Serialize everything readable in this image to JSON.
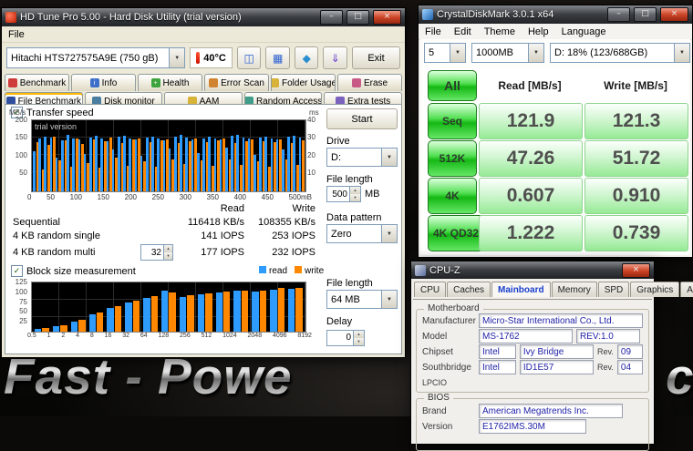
{
  "icons": {
    "minimize": "–",
    "maximize": "□",
    "close": "×",
    "dropdown": "▼",
    "check": "✓",
    "spin_up": "▲",
    "spin_down": "▼",
    "copy": "◫",
    "save": "▦",
    "screenshot": "◆",
    "upload": "⇓"
  },
  "wallpaper": {
    "caption": "Fast - Powe",
    "caption_right": "c"
  },
  "hdtune": {
    "title": "HD Tune Pro 5.00 - Hard Disk Utility (trial version)",
    "menu_file": "File",
    "drive_combo": "Hitachi HTS727575A9E (750 gB)",
    "temperature": "40°C",
    "exit_button": "Exit",
    "tabs_row1": [
      "Benchmark",
      "Info",
      "Health",
      "Error Scan",
      "Folder Usage",
      "Erase"
    ],
    "tabs_row2": [
      "File Benchmark",
      "Disk monitor",
      "AAM",
      "Random Access",
      "Extra tests"
    ],
    "active_tab": "File Benchmark",
    "transfer_speed_checkbox": "Transfer speed",
    "trial_watermark": "trial version",
    "start_button": "Start",
    "drive_label": "Drive",
    "drive_value": "D:",
    "file_length_label": "File length",
    "file_length_value": "500",
    "file_length_unit": "MB",
    "data_pattern_label": "Data pattern",
    "data_pattern_value": "Zero",
    "results_header_read": "Read",
    "results_header_write": "Write",
    "rows": {
      "sequential": {
        "label": "Sequential",
        "read": "116418 KB/s",
        "write": "108355 KB/s"
      },
      "random_single": {
        "label": "4 KB random single",
        "read": "141 IOPS",
        "write": "253 IOPS"
      },
      "random_multi": {
        "label": "4 KB random multi",
        "queue": "32",
        "read": "177 IOPS",
        "write": "232 IOPS"
      }
    },
    "block_checkbox": "Block size measurement",
    "legend_read": "read",
    "legend_write": "write",
    "file_length2_label": "File length",
    "file_length2_value": "64 MB",
    "delay_label": "Delay",
    "delay_value": "0",
    "transfer_chart": {
      "type": "bar",
      "y_unit_left": "MB/s",
      "y_ticks_left": [
        "200",
        "150",
        "100",
        "50"
      ],
      "y_unit_right": "ms",
      "y_ticks_right": [
        "40",
        "30",
        "20",
        "10"
      ],
      "x_ticks": [
        "0",
        "50",
        "100",
        "150",
        "200",
        "250",
        "300",
        "350",
        "400",
        "450",
        "500mB"
      ],
      "y_max": 200,
      "read_color": "#2e9bff",
      "write_color": "#ff8800",
      "read": [
        112,
        148,
        155,
        151,
        96,
        143,
        158,
        150,
        147,
        104,
        152,
        156,
        149,
        141,
        118,
        153,
        157,
        150,
        146,
        99,
        151,
        154,
        148,
        144,
        121,
        155,
        158,
        152,
        147,
        107,
        150,
        153,
        149,
        145,
        124,
        156,
        159,
        151,
        148,
        102,
        152,
        155,
        150,
        146,
        119,
        154,
        157,
        151
      ],
      "write": [
        139,
        62,
        131,
        154,
        88,
        144,
        70,
        149,
        134,
        79,
        147,
        66,
        141,
        151,
        94,
        137,
        73,
        145,
        149,
        84,
        139,
        68,
        143,
        147,
        91,
        135,
        76,
        142,
        150,
        87,
        138,
        71,
        144,
        148,
        89,
        136,
        74,
        140,
        146,
        85,
        141,
        70,
        139,
        145,
        90,
        137,
        75,
        143
      ]
    },
    "block_chart": {
      "type": "bar",
      "categories": [
        "0.5",
        "1",
        "2",
        "4",
        "8",
        "16",
        "32",
        "64",
        "128",
        "256",
        "512",
        "1024",
        "2048",
        "4096",
        "8192"
      ],
      "read": [
        7,
        14,
        26,
        44,
        60,
        73,
        86,
        104,
        89,
        95,
        100,
        104,
        101,
        107,
        108
      ],
      "write": [
        9,
        17,
        30,
        48,
        64,
        78,
        90,
        99,
        92,
        97,
        102,
        105,
        104,
        110,
        112
      ],
      "y_ticks": [
        "125",
        "100",
        "75",
        "50",
        "25"
      ],
      "y_max": 125
    }
  },
  "cdm": {
    "title": "CrystalDiskMark 3.0.1 x64",
    "menu": [
      "File",
      "Edit",
      "Theme",
      "Help",
      "Language"
    ],
    "run_count": "5",
    "test_size": "1000MB",
    "target": "D: 18% (123/688GB)",
    "header_read": "Read [MB/s]",
    "header_write": "Write [MB/s]",
    "all_button": "All",
    "accent_color": "#14b814",
    "tests": [
      {
        "label": "Seq",
        "read": "121.9",
        "write": "121.3"
      },
      {
        "label": "512K",
        "read": "47.26",
        "write": "51.72"
      },
      {
        "label": "4K",
        "read": "0.607",
        "write": "0.910"
      },
      {
        "label": "4K QD32",
        "read": "1.222",
        "write": "0.739"
      }
    ]
  },
  "cpuz": {
    "title": "CPU-Z",
    "tabs": [
      "CPU",
      "Caches",
      "Mainboard",
      "Memory",
      "SPD",
      "Graphics",
      "About"
    ],
    "active_tab": "Mainboard",
    "motherboard_group": "Motherboard",
    "manufacturer_label": "Manufacturer",
    "manufacturer": "Micro-Star International Co., Ltd.",
    "model_label": "Model",
    "model": "MS-1762",
    "model_rev": "REV:1.0",
    "chipset_label": "Chipset",
    "chipset_vendor": "Intel",
    "chipset_name": "Ivy Bridge",
    "chipset_rev_label": "Rev.",
    "chipset_rev": "09",
    "southbridge_label": "Southbridge",
    "southbridge_vendor": "Intel",
    "southbridge_name": "ID1E57",
    "southbridge_rev_label": "Rev.",
    "southbridge_rev": "04",
    "lpcio_label": "LPCIO",
    "bios_group": "BIOS",
    "brand_label": "Brand",
    "brand": "American Megatrends Inc.",
    "version_label": "Version",
    "version": "E1762IMS.30M"
  }
}
